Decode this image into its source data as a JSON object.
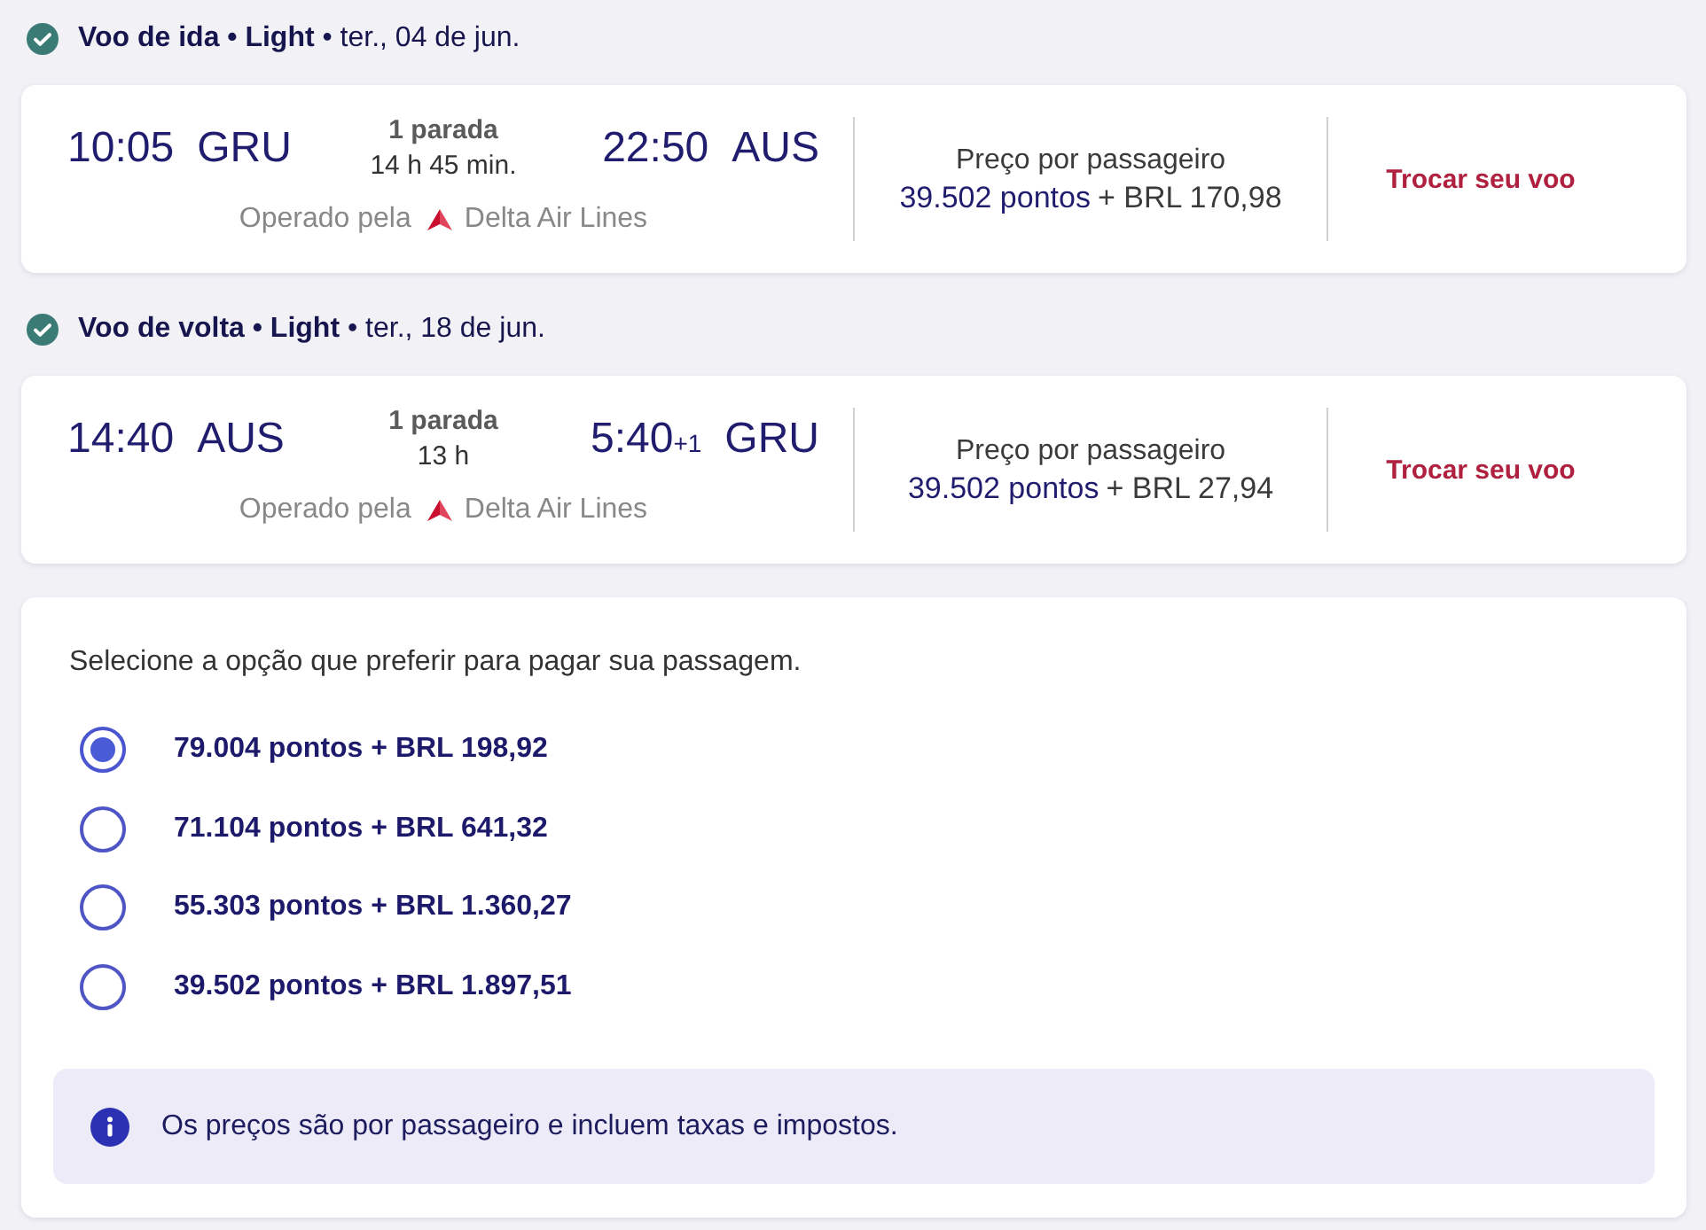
{
  "legs": [
    {
      "heading": "**Voo de ida • Light** • ter., 04 de jun.",
      "departure": {
        "time": "10:05",
        "airport": "GRU"
      },
      "stops": "1 parada",
      "duration": "14 h 45 min.",
      "arrival": {
        "time": "22:50",
        "airport": "AUS"
      },
      "operated_by": "Operado pela",
      "airline": "Delta Air Lines",
      "price_label": "Preço por passageiro",
      "price_points": "39.502 pontos",
      "price_cash": "+ BRL 170,98",
      "action": "Trocar seu voo"
    },
    {
      "heading": "**Voo de volta • Light** • ter., 18 de jun.",
      "departure": {
        "time": "14:40",
        "airport": "AUS"
      },
      "stops": "1 parada",
      "duration": "13 h",
      "arrival": {
        "time": "5:40",
        "day_offset": "+1",
        "airport": "GRU"
      },
      "operated_by": "Operado pela",
      "airline": "Delta Air Lines",
      "price_label": "Preço por passageiro",
      "price_points": "39.502 pontos",
      "price_cash": "+ BRL 27,94",
      "action": "Trocar seu voo"
    }
  ],
  "payment": {
    "prompt": "Selecione a opção que preferir para pagar sua passagem.",
    "options": [
      {
        "label": "79.004 pontos + BRL 198,92",
        "selected": true
      },
      {
        "label": "71.104 pontos + BRL 641,32",
        "selected": false
      },
      {
        "label": "55.303 pontos + BRL 1.360,27",
        "selected": false
      },
      {
        "label": "39.502 pontos + BRL 1.897,51",
        "selected": false
      }
    ],
    "note": "Os preços são por passageiro e incluem taxas e impostos."
  }
}
